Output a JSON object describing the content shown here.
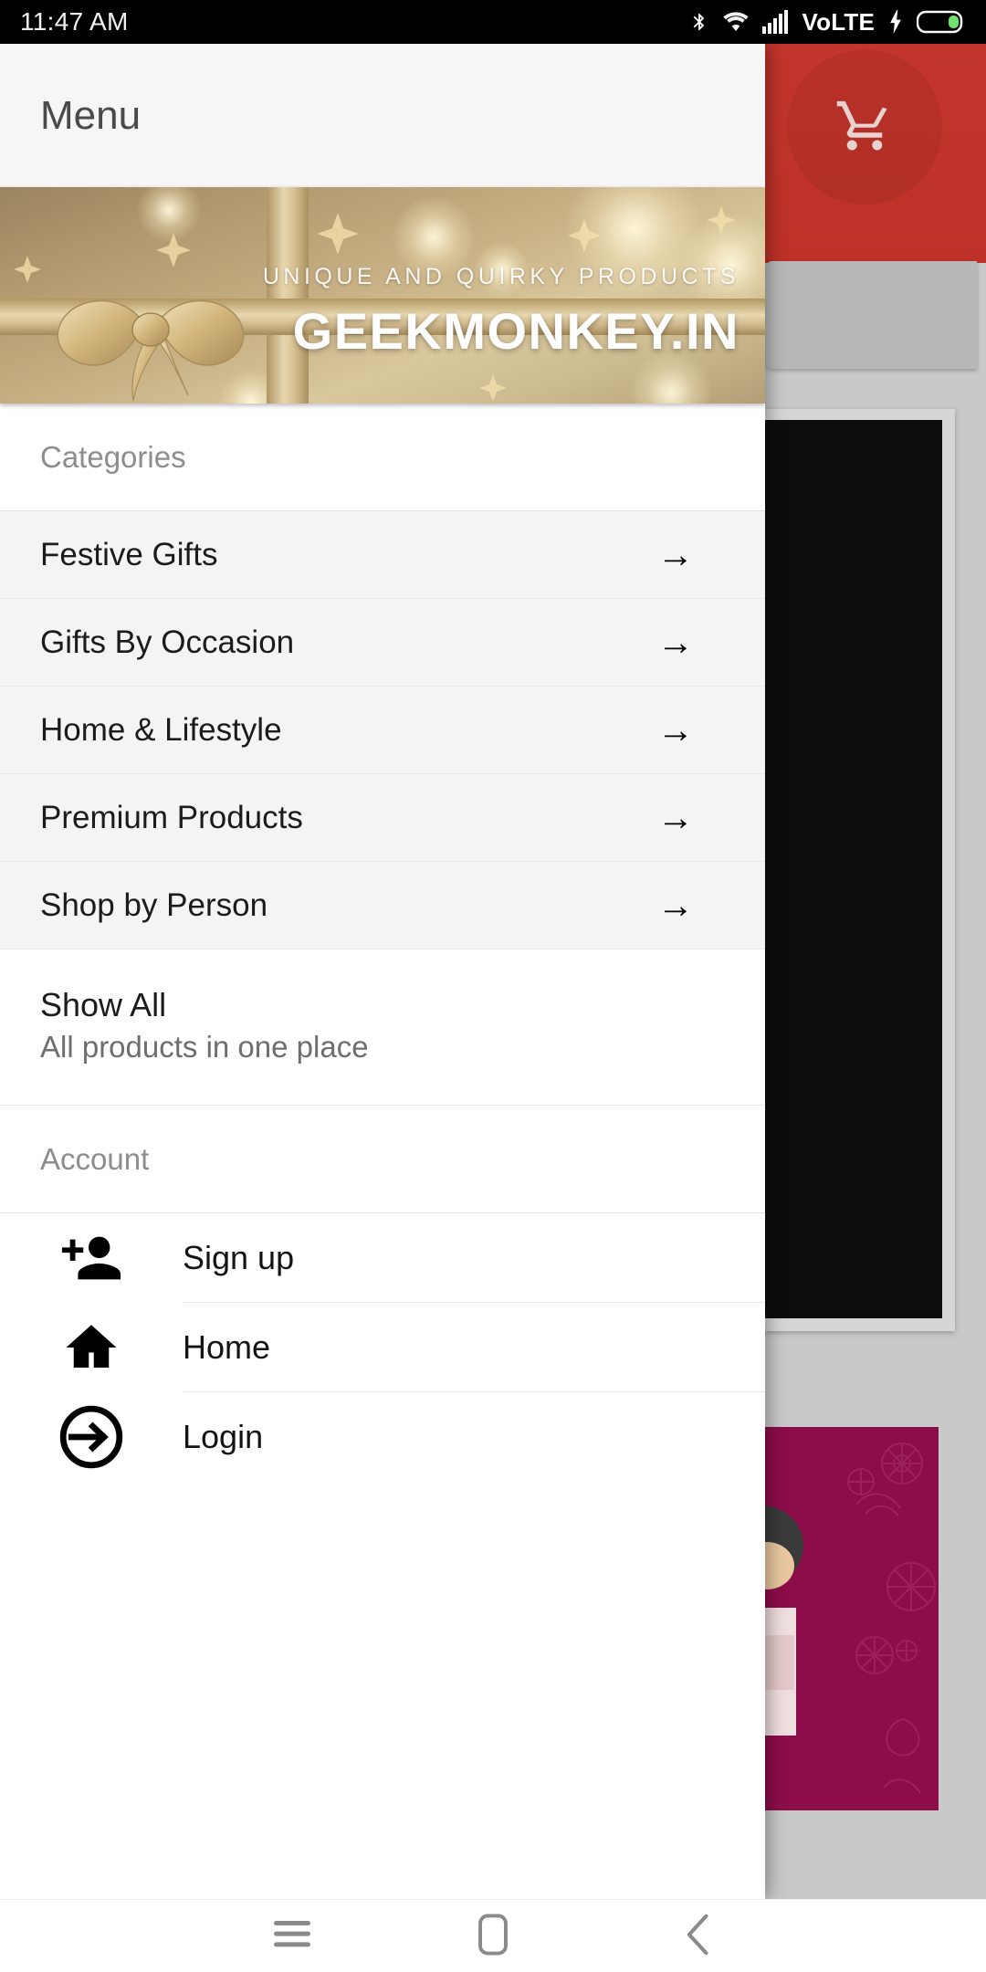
{
  "status_bar": {
    "time": "11:47 AM",
    "network_label": "VoLTE",
    "icons": [
      "bluetooth-icon",
      "wifi-icon",
      "cellular-signal-icon",
      "charging-bolt-icon",
      "battery-icon"
    ]
  },
  "app_background": {
    "app_bar_color": "#c0392b",
    "cart_icon": "shopping-cart-icon",
    "search_bar_color": "#b8b8b8",
    "product_card_dark_color": "#0d0d0d",
    "product_card_pink_color": "#8c0d4a"
  },
  "drawer": {
    "title": "Menu",
    "banner": {
      "tagline": "UNIQUE AND QUIRKY PRODUCTS",
      "brand": "GEEKMONKEY.IN",
      "image_alt": "gold-gift-ribbon-bow-banner"
    },
    "categories_section": {
      "header": "Categories",
      "items": [
        {
          "label": "Festive Gifts",
          "arrow": "→"
        },
        {
          "label": "Gifts By Occasion",
          "arrow": "→"
        },
        {
          "label": "Home & Lifestyle",
          "arrow": "→"
        },
        {
          "label": "Premium Products",
          "arrow": "→"
        },
        {
          "label": "Shop by Person",
          "arrow": "→"
        }
      ],
      "show_all": {
        "title": "Show All",
        "subtitle": "All products in one place"
      }
    },
    "account_section": {
      "header": "Account",
      "items": [
        {
          "label": "Sign up",
          "icon": "person-add-icon"
        },
        {
          "label": "Home",
          "icon": "home-icon"
        },
        {
          "label": "Login",
          "icon": "login-icon"
        }
      ]
    }
  },
  "navigation_bar": {
    "recents": "recents-icon",
    "home": "home-square-icon",
    "back": "back-chevron-icon"
  },
  "colors": {
    "accent_red": "#c0392b",
    "banner_gold": "#c9b286",
    "row_gray": "#f4f4f4",
    "muted_text": "#8d8d8d"
  }
}
